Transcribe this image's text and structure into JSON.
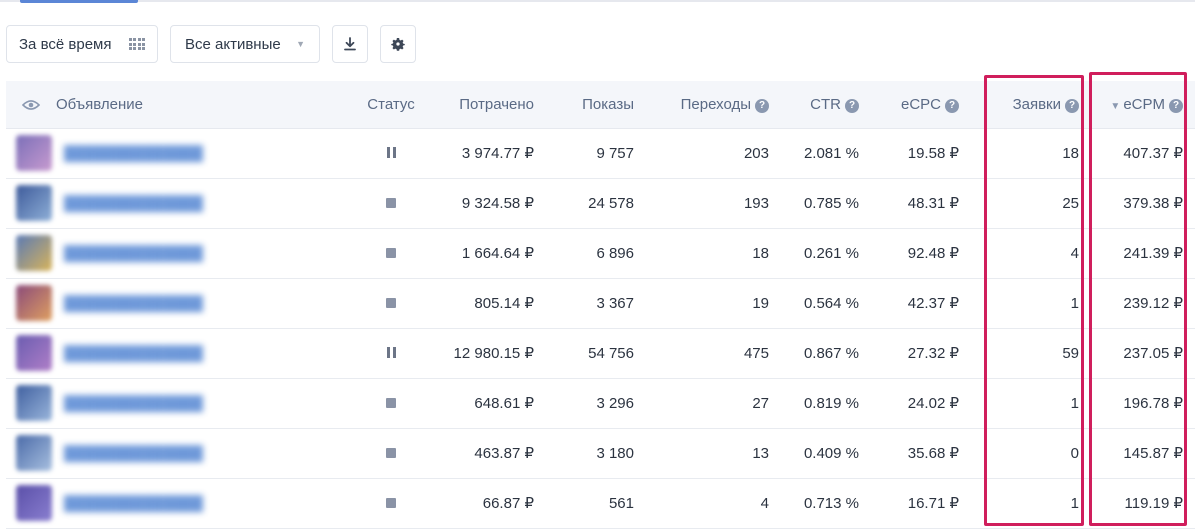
{
  "toolbar": {
    "period_label": "За всё время",
    "filter_label": "Все активные"
  },
  "columns": {
    "ad": "Объявление",
    "status": "Статус",
    "spent": "Потрачено",
    "impressions": "Показы",
    "clicks": "Переходы",
    "ctr": "CTR",
    "ecpc": "eCPC",
    "leads": "Заявки",
    "ecpm": "eCPM"
  },
  "icons": {
    "view": "eye-icon",
    "period": "grid-icon",
    "filter": "chevron-down-icon",
    "download": "download-icon",
    "settings": "gear-icon",
    "help": "question-icon",
    "sort": "sort-down-icon"
  },
  "colors": {
    "highlight": "#d01e5c",
    "accent": "#5b86d6",
    "header_bg": "#f4f6fa"
  },
  "rows": [
    {
      "status": "paused",
      "spent": "3 974.77 ₽",
      "impressions": "9 757",
      "clicks": "203",
      "ctr": "2.081 %",
      "ecpc": "19.58 ₽",
      "leads": "18",
      "ecpm": "407.37 ₽"
    },
    {
      "status": "stopped",
      "spent": "9 324.58 ₽",
      "impressions": "24 578",
      "clicks": "193",
      "ctr": "0.785 %",
      "ecpc": "48.31 ₽",
      "leads": "25",
      "ecpm": "379.38 ₽"
    },
    {
      "status": "stopped",
      "spent": "1 664.64 ₽",
      "impressions": "6 896",
      "clicks": "18",
      "ctr": "0.261 %",
      "ecpc": "92.48 ₽",
      "leads": "4",
      "ecpm": "241.39 ₽"
    },
    {
      "status": "stopped",
      "spent": "805.14 ₽",
      "impressions": "3 367",
      "clicks": "19",
      "ctr": "0.564 %",
      "ecpc": "42.37 ₽",
      "leads": "1",
      "ecpm": "239.12 ₽"
    },
    {
      "status": "paused",
      "spent": "12 980.15 ₽",
      "impressions": "54 756",
      "clicks": "475",
      "ctr": "0.867 %",
      "ecpc": "27.32 ₽",
      "leads": "59",
      "ecpm": "237.05 ₽"
    },
    {
      "status": "stopped",
      "spent": "648.61 ₽",
      "impressions": "3 296",
      "clicks": "27",
      "ctr": "0.819 %",
      "ecpc": "24.02 ₽",
      "leads": "1",
      "ecpm": "196.78 ₽"
    },
    {
      "status": "stopped",
      "spent": "463.87 ₽",
      "impressions": "3 180",
      "clicks": "13",
      "ctr": "0.409 %",
      "ecpc": "35.68 ₽",
      "leads": "0",
      "ecpm": "145.87 ₽"
    },
    {
      "status": "stopped",
      "spent": "66.87 ₽",
      "impressions": "561",
      "clicks": "4",
      "ctr": "0.713 %",
      "ecpc": "16.71 ₽",
      "leads": "1",
      "ecpm": "119.19 ₽"
    }
  ]
}
